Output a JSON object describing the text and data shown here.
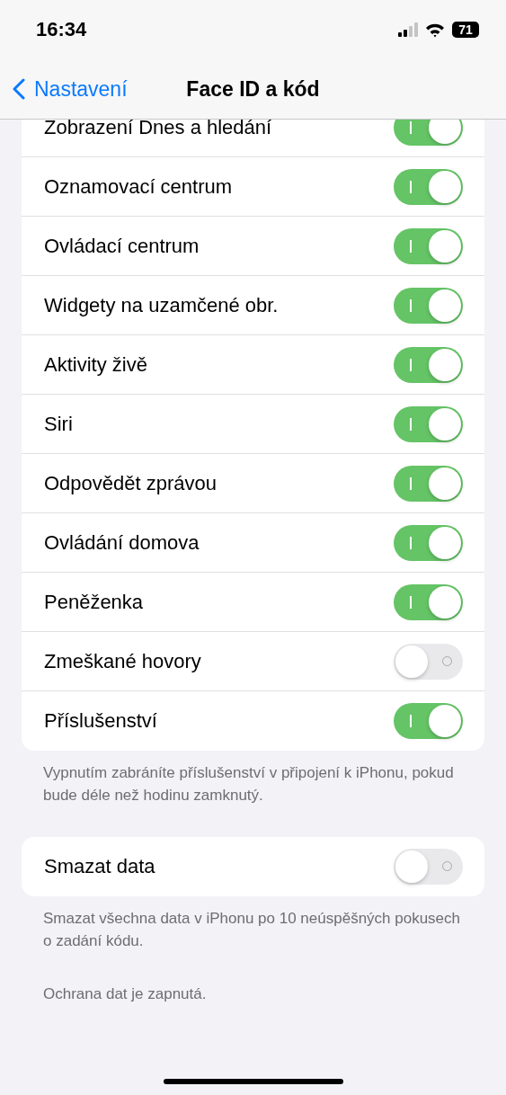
{
  "status_bar": {
    "time": "16:34",
    "battery": "71"
  },
  "nav": {
    "back": "Nastavení",
    "title": "Face ID a kód"
  },
  "lock_access": {
    "rows": [
      {
        "label": "Zobrazení Dnes a hledání",
        "on": true
      },
      {
        "label": "Oznamovací centrum",
        "on": true
      },
      {
        "label": "Ovládací centrum",
        "on": true
      },
      {
        "label": "Widgety na uzamčené obr.",
        "on": true
      },
      {
        "label": "Aktivity živě",
        "on": true
      },
      {
        "label": "Siri",
        "on": true
      },
      {
        "label": "Odpovědět zprávou",
        "on": true
      },
      {
        "label": "Ovládání domova",
        "on": true
      },
      {
        "label": "Peněženka",
        "on": true
      },
      {
        "label": "Zmeškané hovory",
        "on": false
      },
      {
        "label": "Příslušenství",
        "on": true
      }
    ],
    "footer": "Vypnutím zabráníte příslušenství v připojení k iPhonu, pokud bude déle než hodinu zamknutý."
  },
  "erase": {
    "rows": [
      {
        "label": "Smazat data",
        "on": false
      }
    ],
    "footer": "Smazat všechna data v iPhonu po 10 neúspěšných pokusech o zadání kódu.",
    "note": "Ochrana dat je zapnutá."
  }
}
